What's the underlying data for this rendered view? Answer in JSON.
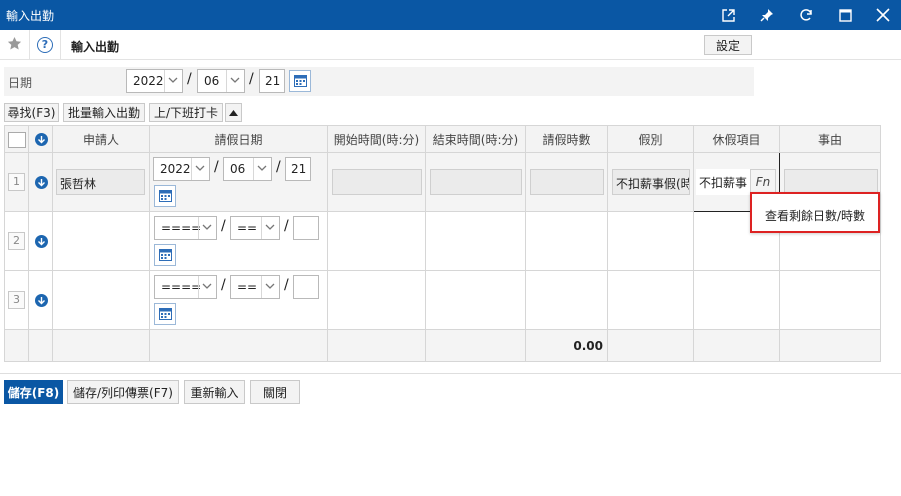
{
  "window": {
    "title": "輸入出勤"
  },
  "subbar": {
    "title": "輸入出勤",
    "settings_label": "設定",
    "help_glyph": "?"
  },
  "filter": {
    "date_label": "日期",
    "year": "2022",
    "month": "06",
    "day": "21",
    "sep": "/"
  },
  "toolbar": {
    "find_label": "尋找(F3)",
    "batch_label": "批量輸入出勤",
    "clock_label": "上/下班打卡"
  },
  "table": {
    "headers": [
      "申請人",
      "請假日期",
      "開始時間(時:分)",
      "結束時間(時:分)",
      "請假時數",
      "假別",
      "休假項目",
      "事由"
    ],
    "rows": [
      {
        "num": "1",
        "applicant": "張哲林",
        "year": "2022",
        "month": "06",
        "day": "21",
        "leave_type": "不扣薪事假(時",
        "leave_item": "不扣薪事",
        "fn": "Fn"
      },
      {
        "num": "2",
        "applicant": "",
        "year": "====",
        "month": "==",
        "day": ""
      },
      {
        "num": "3",
        "applicant": "",
        "year": "====",
        "month": "==",
        "day": ""
      }
    ],
    "total_hours": "0.00"
  },
  "popup": {
    "label": "查看剩餘日數/時數"
  },
  "footer": {
    "save_label": "儲存(F8)",
    "save_print_label": "儲存/列印傳票(F7)",
    "reset_label": "重新輸入",
    "close_label": "關閉"
  },
  "colors": {
    "titlebar": "#0a57a4",
    "accent": "#1d66b0",
    "popup_border": "#dd2222"
  }
}
